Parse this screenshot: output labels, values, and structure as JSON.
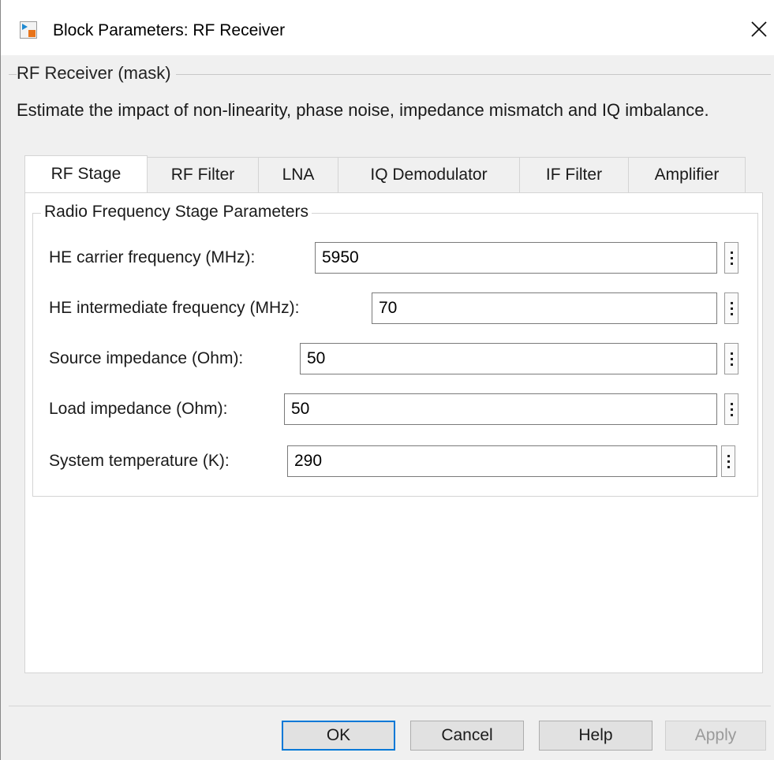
{
  "window": {
    "title": "Block Parameters: RF Receiver",
    "icon": "simulink-block-icon",
    "close_icon": "close-icon",
    "close_glyph": "✕"
  },
  "mask": {
    "group_title": "RF Receiver (mask)",
    "description": "Estimate the impact of non-linearity, phase noise, impedance mismatch and IQ imbalance."
  },
  "tabs": [
    {
      "label": "RF Stage",
      "active": true
    },
    {
      "label": "RF Filter",
      "active": false
    },
    {
      "label": "LNA",
      "active": false
    },
    {
      "label": "IQ Demodulator",
      "active": false
    },
    {
      "label": "IF Filter",
      "active": false
    },
    {
      "label": "Amplifier",
      "active": false
    }
  ],
  "panel": {
    "legend": "Radio Frequency Stage Parameters",
    "params": [
      {
        "label": "HE carrier frequency (MHz):",
        "value": "5950"
      },
      {
        "label": "HE intermediate frequency (MHz):",
        "value": "70"
      },
      {
        "label": "Source impedance (Ohm):",
        "value": "50"
      },
      {
        "label": "Load impedance (Ohm):",
        "value": "50"
      },
      {
        "label": "System temperature (K):",
        "value": "290"
      }
    ]
  },
  "buttons": {
    "ok": "OK",
    "cancel": "Cancel",
    "help": "Help",
    "apply": "Apply"
  },
  "colors": {
    "accent": "#0078d7",
    "background": "#f0f0f0",
    "panel": "#ffffff"
  }
}
